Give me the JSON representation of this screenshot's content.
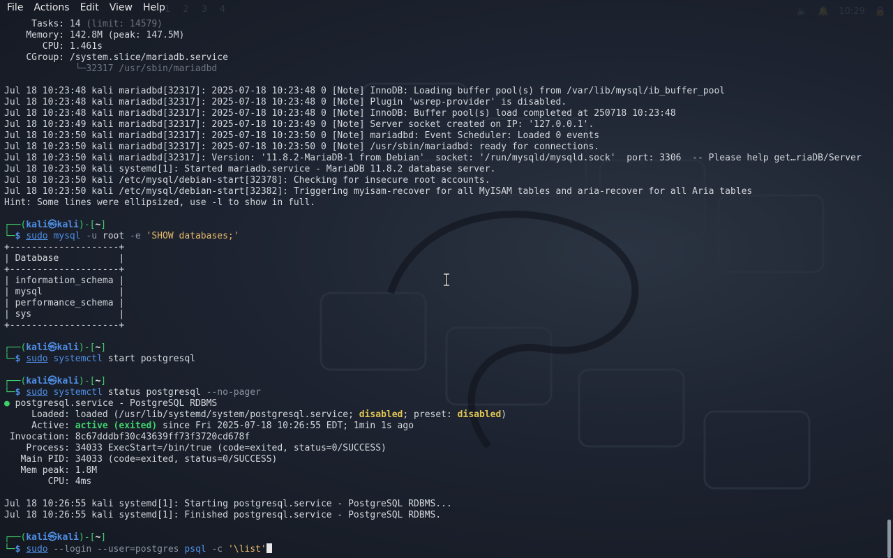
{
  "menu": {
    "items": [
      "File",
      "Actions",
      "Edit",
      "View",
      "Help"
    ]
  },
  "panel": {
    "workspaces": [
      "1",
      "2",
      "3",
      "4"
    ],
    "clock": "10:29"
  },
  "terminal": {
    "status_tail": {
      "tasks_label": "Tasks:",
      "tasks_value": "14",
      "tasks_limit": "(limit: 14579)",
      "memory_label": "Memory:",
      "memory_value": "142.8M (peak: 147.5M)",
      "cpu_label": "CPU:",
      "cpu_value": "1.461s",
      "cgroup_label": "CGroup:",
      "cgroup_value": "/system.slice/mariadb.service",
      "cgroup_tree": "└─32317 /usr/sbin/mariadbd"
    },
    "mariadb_logs": [
      "Jul 18 10:23:48 kali mariadbd[32317]: 2025-07-18 10:23:48 0 [Note] InnoDB: Loading buffer pool(s) from /var/lib/mysql/ib_buffer_pool",
      "Jul 18 10:23:48 kali mariadbd[32317]: 2025-07-18 10:23:48 0 [Note] Plugin 'wsrep-provider' is disabled.",
      "Jul 18 10:23:48 kali mariadbd[32317]: 2025-07-18 10:23:48 0 [Note] InnoDB: Buffer pool(s) load completed at 250718 10:23:48",
      "Jul 18 10:23:49 kali mariadbd[32317]: 2025-07-18 10:23:49 0 [Note] Server socket created on IP: '127.0.0.1'.",
      "Jul 18 10:23:50 kali mariadbd[32317]: 2025-07-18 10:23:50 0 [Note] mariadbd: Event Scheduler: Loaded 0 events",
      "Jul 18 10:23:50 kali mariadbd[32317]: 2025-07-18 10:23:50 0 [Note] /usr/sbin/mariadbd: ready for connections.",
      "Jul 18 10:23:50 kali mariadbd[32317]: Version: '11.8.2-MariaDB-1 from Debian'  socket: '/run/mysqld/mysqld.sock'  port: 3306  -- Please help get…riaDB/Server",
      "Jul 18 10:23:50 kali systemd[1]: Started mariadb.service - MariaDB 11.8.2 database server.",
      "Jul 18 10:23:50 kali /etc/mysql/debian-start[32378]: Checking for insecure root accounts.",
      "Jul 18 10:23:50 kali /etc/mysql/debian-start[32382]: Triggering myisam-recover for all MyISAM tables and aria-recover for all Aria tables"
    ],
    "hint": "Hint: Some lines were ellipsized, use -l to show in full.",
    "prompt": {
      "top_left": "┌──(",
      "user": "kali",
      "at": "㉿",
      "host": "kali",
      "mid": ")-[",
      "dir": "~",
      "end": "]",
      "bottom": "└─",
      "dollar": "$"
    },
    "cmd1": {
      "sudo": "sudo",
      "bin": "mysql",
      "opt1": "-u",
      "arg1": "root",
      "opt2": "-e",
      "str": "'SHOW databases;'"
    },
    "db_table": {
      "border": "+--------------------+",
      "header": "| Database           |",
      "rows": [
        "| information_schema |",
        "| mysql              |",
        "| performance_schema |",
        "| sys                |"
      ]
    },
    "cmd2": {
      "sudo": "sudo",
      "bin": "systemctl",
      "arg1": "start",
      "arg2": "postgresql"
    },
    "cmd3": {
      "sudo": "sudo",
      "bin": "systemctl",
      "arg1": "status",
      "arg2": "postgresql",
      "opt1": "--no-pager"
    },
    "pg_status": {
      "bullet": "●",
      "unit": "postgresql.service - PostgreSQL RDBMS",
      "loaded_label": "Loaded:",
      "loaded_pre": "loaded (/usr/lib/systemd/system/postgresql.service;",
      "loaded_disabled1": "disabled",
      "loaded_mid": "; preset:",
      "loaded_disabled2": "disabled",
      "loaded_post": ")",
      "active_label": "Active:",
      "active_state": "active (exited)",
      "active_rest": "since Fri 2025-07-18 10:26:55 EDT; 1min 1s ago",
      "invocation_label": "Invocation:",
      "invocation_value": "8c67dddbf30c43639ff73f3720cd678f",
      "process_label": "Process:",
      "process_value": "34033 ExecStart=/bin/true (code=exited, status=0/SUCCESS)",
      "mainpid_label": "Main PID:",
      "mainpid_value": "34033 (code=exited, status=0/SUCCESS)",
      "mempeak_label": "Mem peak:",
      "mempeak_value": "1.8M",
      "cpu_label": "CPU:",
      "cpu_value": "4ms"
    },
    "pg_logs": [
      "Jul 18 10:26:55 kali systemd[1]: Starting postgresql.service - PostgreSQL RDBMS...",
      "Jul 18 10:26:55 kali systemd[1]: Finished postgresql.service - PostgreSQL RDBMS."
    ],
    "cmd4": {
      "sudo": "sudo",
      "opt1": "--login",
      "opt2": "--user=postgres",
      "bin": "psql",
      "opt3": "-c",
      "str": "'\\list'"
    }
  },
  "colors": {
    "prompt_blue": "#4f8fe6",
    "active_green": "#3fd46e",
    "disabled_yellow": "#e1c552",
    "text": "#d4d7dc"
  }
}
